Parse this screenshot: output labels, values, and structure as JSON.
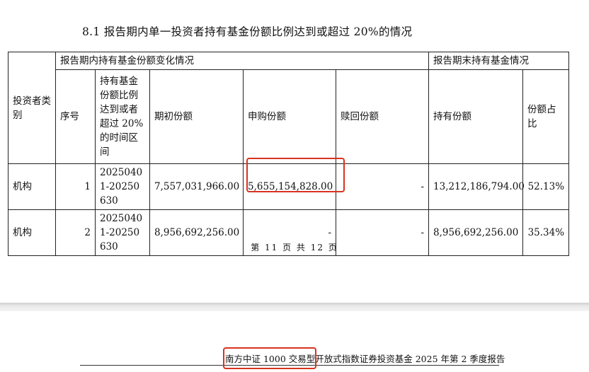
{
  "section": {
    "title": "8.1  报告期内单一投资者持有基金份额比例达到或超过 20%的情况"
  },
  "table": {
    "group_left": "报告期内持有基金份额变化情况",
    "group_right": "报告期末持有基金情况",
    "headers": {
      "investor_type": "投资者类别",
      "seq": "序号",
      "period": "持有基金份额比例达到或者超过 20%的时间区间",
      "initial": "期初份额",
      "subscribe": "申购份额",
      "redeem": "赎回份额",
      "holding": "持有份额",
      "ratio": "份额占比"
    },
    "rows": [
      {
        "investor_type": "机构",
        "seq": "1",
        "period": "20250401-20250630",
        "initial": "7,557,031,966.00",
        "subscribe": "5,655,154,828.00",
        "redeem": "-",
        "holding": "13,212,186,794.00",
        "ratio": "52.13%"
      },
      {
        "investor_type": "机构",
        "seq": "2",
        "period": "20250401-20250630",
        "initial": "8,956,692,256.00",
        "subscribe": "-",
        "redeem": "-",
        "holding": "8,956,692,256.00",
        "ratio": "35.34%"
      }
    ]
  },
  "page_number": "第 11 页 共 12 页",
  "footer": {
    "report_title": "南方中证 1000 交易型开放式指数证券投资基金 2025 年第 2 季度报告"
  },
  "colors": {
    "highlight": "#d8331f",
    "page_gap": "#e2e2e2"
  }
}
